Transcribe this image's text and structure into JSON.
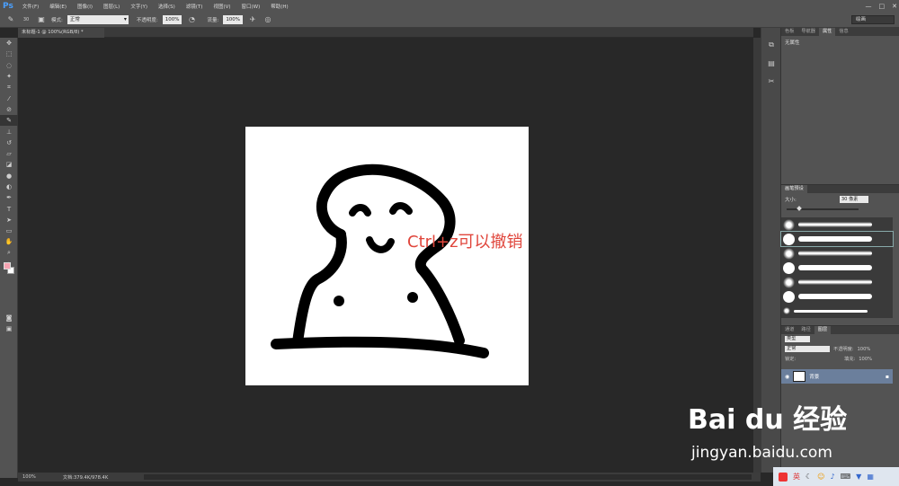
{
  "app": {
    "logo": "Ps"
  },
  "menu": [
    "文件(F)",
    "编辑(E)",
    "图像(I)",
    "图层(L)",
    "文字(Y)",
    "选择(S)",
    "滤镜(T)",
    "视图(V)",
    "窗口(W)",
    "帮助(H)"
  ],
  "window_controls": [
    "—",
    "□",
    "✕"
  ],
  "options": {
    "brush_size": "30",
    "mode_label": "模式:",
    "mode_value": "正常",
    "opacity_label": "不透明度:",
    "opacity_value": "100%",
    "flow_label": "流量:",
    "flow_value": "100%"
  },
  "workspace": "绘画",
  "document": {
    "tab_title": "未标题-1 @ 100%(RGB/8) *",
    "annotation": "Ctrl+z可以撤销"
  },
  "status": {
    "zoom": "100%",
    "doc_info": "文档:379.4K/978.4K"
  },
  "panels": {
    "top_tabs": [
      "色板",
      "导航器",
      "属性",
      "信息"
    ],
    "properties_text": "无属性",
    "brush_tabs": [
      "画笔预设"
    ],
    "brush_size_label": "大小:",
    "brush_size_value": "30 像素",
    "layer_tabs": [
      "通道",
      "路径",
      "图层"
    ],
    "layer_kind": "类型",
    "blend_mode": "正常",
    "opacity_label": "不透明度:",
    "opacity_value": "100%",
    "lock_label": "锁定:",
    "fill_label": "填充:",
    "fill_value": "100%",
    "layer_name": "背景"
  },
  "watermark": {
    "brand": "Bai du 经验",
    "url": "jingyan.baidu.com"
  },
  "taskbar": {
    "ime": "英"
  },
  "colors": {
    "foreground": "#f5a3b1",
    "background": "#ffffff",
    "annotation": "#e0463c"
  }
}
